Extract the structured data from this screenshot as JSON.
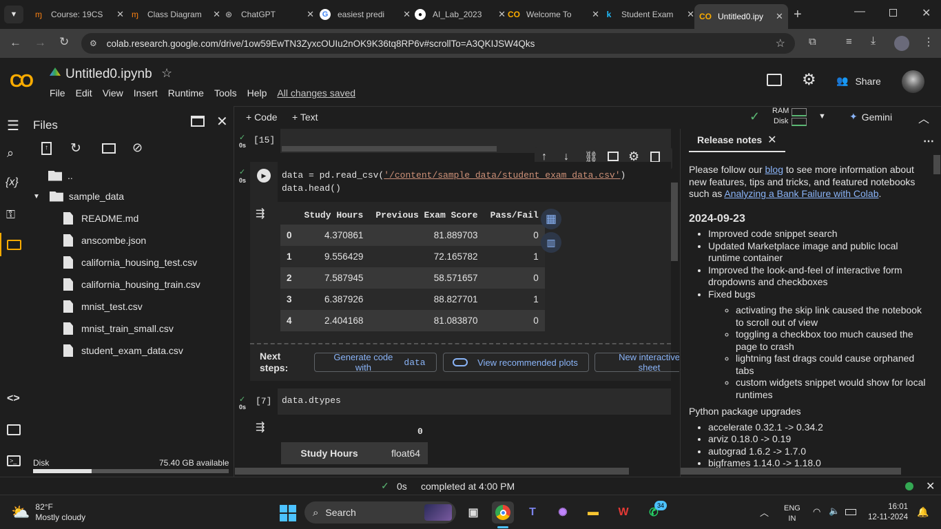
{
  "browser": {
    "tabs": [
      {
        "label": "Course: 19CS",
        "icon": "moodle-icon"
      },
      {
        "label": "Class Diagram",
        "icon": "moodle-icon"
      },
      {
        "label": "ChatGPT",
        "icon": "chatgpt-icon"
      },
      {
        "label": "easiest predi",
        "icon": "google-icon"
      },
      {
        "label": "AI_Lab_2023",
        "icon": "github-icon"
      },
      {
        "label": "Welcome To",
        "icon": "colab-icon"
      },
      {
        "label": "Student Exam",
        "icon": "kaggle-icon"
      },
      {
        "label": "Untitled0.ipy",
        "icon": "colab-icon"
      }
    ],
    "url": "colab.research.google.com/drive/1ow59EwTN3ZyxcOUIu2nOK9K36tq8RP6v#scrollTo=A3QKIJSW4Qks"
  },
  "colab": {
    "notebook_title": "Untitled0.ipynb",
    "menu": [
      "File",
      "Edit",
      "View",
      "Insert",
      "Runtime",
      "Tools",
      "Help"
    ],
    "save_status": "All changes saved",
    "share_label": "Share",
    "add_code": "+ Code",
    "add_text": "+ Text",
    "ram_label": "RAM",
    "disk_label": "Disk",
    "gemini_label": "Gemini"
  },
  "files_panel": {
    "title": "Files",
    "parent": "..",
    "folder": "sample_data",
    "files": [
      "README.md",
      "anscombe.json",
      "california_housing_test.csv",
      "california_housing_train.csv",
      "mnist_test.csv",
      "mnist_train_small.csv",
      "student_exam_data.csv"
    ],
    "disk_label": "Disk",
    "disk_available": "75.40 GB available",
    "disk_used_fraction": 0.3
  },
  "cells": {
    "cell1": {
      "exec": "[15]",
      "time": "0s"
    },
    "cell2": {
      "time": "0s",
      "line1_a": "data = pd.read_csv(",
      "line1_str": "'/content/sample_data/student_exam_data.csv'",
      "line1_b": ")",
      "line2": "data.head()",
      "columns": [
        "",
        "Study Hours",
        "Previous Exam Score",
        "Pass/Fail"
      ],
      "rows": [
        [
          "0",
          "4.370861",
          "81.889703",
          "0"
        ],
        [
          "1",
          "9.556429",
          "72.165782",
          "1"
        ],
        [
          "2",
          "7.587945",
          "58.571657",
          "0"
        ],
        [
          "3",
          "6.387926",
          "88.827701",
          "1"
        ],
        [
          "4",
          "2.404168",
          "81.083870",
          "0"
        ]
      ],
      "next_steps_label": "Next steps:",
      "btn_generate": "Generate code with",
      "btn_generate_code": "data",
      "btn_plots": "View recommended plots",
      "btn_sheet": "New interactive sheet"
    },
    "cell3": {
      "exec": "[7]",
      "time": "0s",
      "code": "data.dtypes",
      "header": "0",
      "row_label": "Study Hours",
      "row_value": "float64"
    }
  },
  "release_notes": {
    "tab_label": "Release notes",
    "intro_a": "Please follow our ",
    "intro_link1": "blog",
    "intro_b": " to see more information about new features, tips and tricks, and featured notebooks such as ",
    "intro_link2": "Analyzing a Bank Failure with Colab",
    "intro_c": ".",
    "date": "2024-09-23",
    "items": [
      "Improved code snippet search",
      "Updated Marketplace image and public local runtime container",
      "Improved the look-and-feel of interactive form dropdowns and checkboxes",
      "Fixed bugs"
    ],
    "bugs": [
      "activating the skip link caused the notebook to scroll out of view",
      "toggling a checkbox too much caused the page to crash",
      "lightning fast drags could cause orphaned tabs",
      "custom widgets snippet would show for local runtimes"
    ],
    "upgrades_title": "Python package upgrades",
    "upgrades": [
      "accelerate 0.32.1 -> 0.34.2",
      "arviz 0.18.0 -> 0.19",
      "autograd 1.6.2 -> 1.7.0",
      "bigframes 1.14.0 -> 1.18.0"
    ]
  },
  "status": {
    "time": "0s",
    "completed": "completed at 4:00 PM"
  },
  "taskbar": {
    "temp": "82°F",
    "weather": "Mostly cloudy",
    "search": "Search",
    "lang1": "ENG",
    "lang2": "IN",
    "time": "16:01",
    "date": "12-11-2024",
    "whatsapp_badge": "34"
  },
  "colors": {
    "accent": "#8ab4f8",
    "success": "#5bb974",
    "colab_orange": "#f9ab00"
  }
}
